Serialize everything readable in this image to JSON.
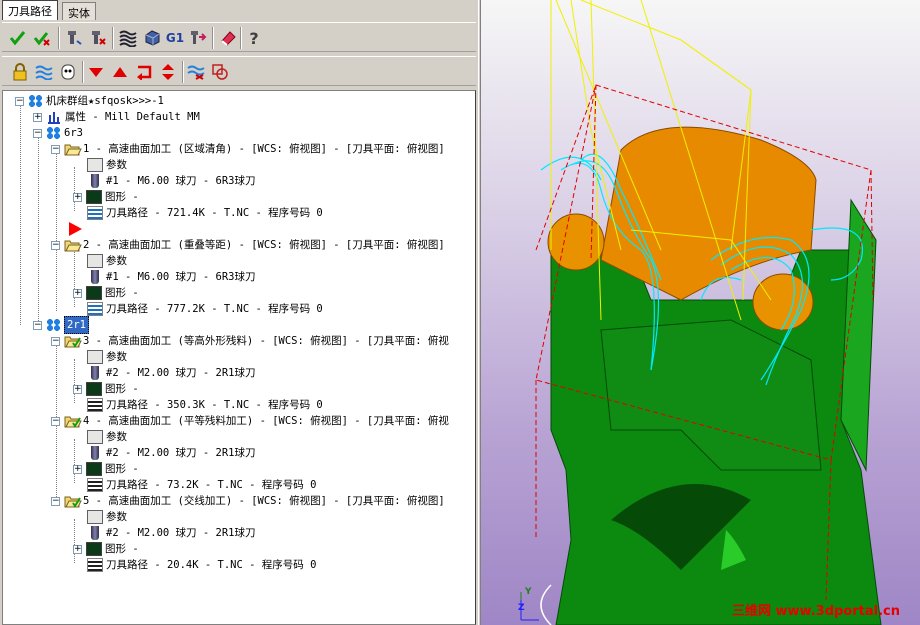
{
  "tabs": [
    "刀具路径",
    "实体"
  ],
  "toolbar1": [
    "select-all-ops-icon",
    "regenerate-icon",
    "backplot-icon",
    "delete-icon",
    "verify-icon",
    "solid-sim-icon",
    "post-g1-icon",
    "post-output-icon",
    "eraser-icon",
    "help-icon"
  ],
  "toolbar1_g1": "G1",
  "toolbar2": [
    "lock-icon",
    "toolpath-display-icon",
    "post-flag-icon",
    "move-down-icon",
    "move-up-icon",
    "insert-arrow-icon",
    "scroll-icon",
    "toggle-path-icon",
    "view-select-icon"
  ],
  "tree": {
    "root": "机床群组★sfqosk>>>-1",
    "props": "属性 - Mill Default MM",
    "group1": "6r3",
    "op1": "1 - 高速曲面加工 (区域清角) - [WCS: 俯视图] - [刀具平面: 俯视图]",
    "op1_param": "参数",
    "op1_tool": "#1 - M6.00 球刀 - 6R3球刀",
    "op1_geo": "图形 -",
    "op1_path": "刀具路径 - 721.4K - T.NC - 程序号码 0",
    "op2": "2 - 高速曲面加工 (重叠等距) - [WCS: 俯视图] - [刀具平面: 俯视图]",
    "op2_param": "参数",
    "op2_tool": "#1 - M6.00 球刀 - 6R3球刀",
    "op2_geo": "图形 -",
    "op2_path": "刀具路径 - 777.2K - T.NC - 程序号码 0",
    "group2": "2r1",
    "op3": "3 - 高速曲面加工 (等高外形残料) - [WCS: 俯视图] - [刀具平面: 俯视",
    "op3_param": "参数",
    "op3_tool": "#2 - M2.00 球刀 - 2R1球刀",
    "op3_geo": "图形 -",
    "op3_path": "刀具路径 - 350.3K - T.NC - 程序号码 0",
    "op4": "4 - 高速曲面加工 (平等残料加工) - [WCS: 俯视图] - [刀具平面: 俯视",
    "op4_param": "参数",
    "op4_tool": "#2 - M2.00 球刀 - 2R1球刀",
    "op4_geo": "图形 -",
    "op4_path": "刀具路径 - 73.2K - T.NC - 程序号码 0",
    "op5": "5 - 高速曲面加工 (交线加工) - [WCS: 俯视图] - [刀具平面: 俯视图]",
    "op5_param": "参数",
    "op5_tool": "#2 - M2.00 球刀 - 2R1球刀",
    "op5_geo": "图形 -",
    "op5_path": "刀具路径 - 20.4K - T.NC - 程序号码 0"
  },
  "viewport": {
    "axis_y": "Y",
    "axis_z": "Z",
    "watermark": "三维网 www.3dportal.cn"
  },
  "colors": {
    "model_green": "#0c8a10",
    "model_orange": "#e88a00",
    "toolpath_cyan": "#00e8ff",
    "toolpath_yellow": "#f0f000",
    "bounding_box": "#e00000"
  }
}
